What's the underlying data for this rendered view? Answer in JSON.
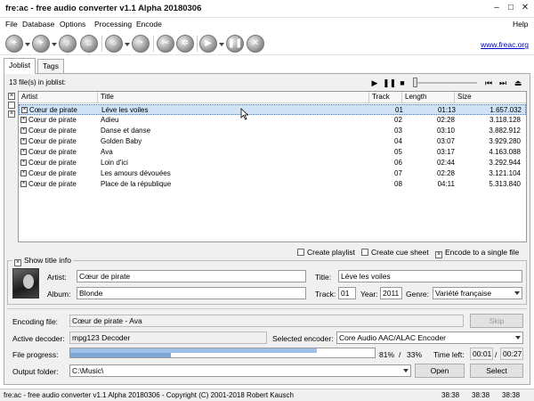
{
  "window": {
    "title": "fre:ac - free audio converter v1.1 Alpha 20180306",
    "minimize": "–",
    "maximize": "□",
    "close": "✕"
  },
  "menu": {
    "items": [
      "File",
      "Database",
      "Options",
      "Processing",
      "Encode"
    ],
    "help": "Help"
  },
  "toolbar": {
    "website": "www.freac.org",
    "icons": [
      "add-files-icon",
      "add-folder-icon",
      "remove-icon",
      "clear-icon",
      "cddb-query-icon",
      "cddb-submit-icon",
      "config-icon",
      "settings-icon",
      "play-encode-icon",
      "pause-icon",
      "stop-icon"
    ]
  },
  "tabs": [
    "Joblist",
    "Tags"
  ],
  "joblist": {
    "count_text": "13 file(s) in joblist:",
    "headers": {
      "artist": "Artist",
      "title": "Title",
      "track": "Track",
      "length": "Length",
      "size": "Size"
    },
    "rows": [
      {
        "artist": "Cœur de pirate",
        "title": "Léve les voiles",
        "track": "01",
        "length": "01:13",
        "size": "1.657.032"
      },
      {
        "artist": "Cœur de pirate",
        "title": "Adieu",
        "track": "02",
        "length": "02:28",
        "size": "3.118.128"
      },
      {
        "artist": "Cœur de pirate",
        "title": "Danse et danse",
        "track": "03",
        "length": "03:10",
        "size": "3.882.912"
      },
      {
        "artist": "Cœur de pirate",
        "title": "Golden Baby",
        "track": "04",
        "length": "03:07",
        "size": "3.929.280"
      },
      {
        "artist": "Cœur de pirate",
        "title": "Ava",
        "track": "05",
        "length": "03:17",
        "size": "4.163.088"
      },
      {
        "artist": "Cœur de pirate",
        "title": "Loin d'ici",
        "track": "06",
        "length": "02:44",
        "size": "3.292.944"
      },
      {
        "artist": "Cœur de pirate",
        "title": "Les amours dévouées",
        "track": "07",
        "length": "02:28",
        "size": "3.121.104"
      },
      {
        "artist": "Cœur de pirate",
        "title": "Place de la république",
        "track": "08",
        "length": "04:11",
        "size": "5.313.840"
      }
    ]
  },
  "options": {
    "create_playlist": "Create playlist",
    "create_cue": "Create cue sheet",
    "single_file": "Encode to a single file"
  },
  "title_info": {
    "legend": "Show title info",
    "artist_label": "Artist:",
    "artist": "Cœur de pirate",
    "title_label": "Title:",
    "title": "Léve les voiles",
    "album_label": "Album:",
    "album": "Blonde",
    "track_label": "Track:",
    "track": "01",
    "year_label": "Year:",
    "year": "2011",
    "genre_label": "Genre:",
    "genre": "Variété française"
  },
  "encoding": {
    "file_label": "Encoding file:",
    "file": "Cœur de pirate - Ava",
    "skip": "Skip",
    "decoder_label": "Active decoder:",
    "decoder": "mpg123 Decoder",
    "encoder_label": "Selected encoder:",
    "encoder": "Core Audio AAC/ALAC Encoder",
    "progress_label": "File progress:",
    "file_progress": 81,
    "file_progress_text": "81%",
    "slash": "/",
    "total_progress": 33,
    "total_progress_text": "33%",
    "time_left_label": "Time left:",
    "time_left": "00:01",
    "time_left_total": "00:27",
    "output_label": "Output folder:",
    "output": "C:\\Music\\",
    "open": "Open",
    "select": "Select"
  },
  "status": {
    "text": "fre:ac - free audio converter v1.1 Alpha 20180306 - Copyright (C) 2001-2018 Robert Kausch",
    "time1": "38:38",
    "time2": "38:38",
    "time3": "38:38"
  }
}
